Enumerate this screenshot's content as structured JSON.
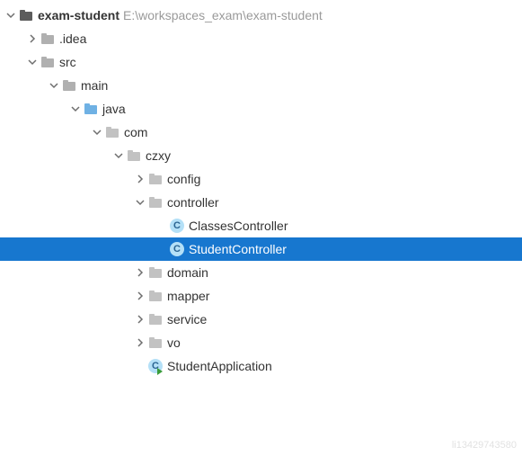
{
  "root": {
    "name": "exam-student",
    "path": "E:\\workspaces_exam\\exam-student"
  },
  "nodes": {
    "idea": ".idea",
    "src": "src",
    "main": "main",
    "java": "java",
    "com": "com",
    "czxy": "czxy",
    "config": "config",
    "controller": "controller",
    "classesController": "ClassesController",
    "studentController": "StudentController",
    "domain": "domain",
    "mapper": "mapper",
    "service": "service",
    "vo": "vo",
    "studentApplication": "StudentApplication"
  },
  "iconLetters": {
    "class": "C"
  },
  "colors": {
    "selection": "#1777cf",
    "folderFill": "#b0b0b0",
    "folderJava": "#6fb1e4",
    "classCircle": "#b4e0f7"
  },
  "watermark": "li13429743580"
}
